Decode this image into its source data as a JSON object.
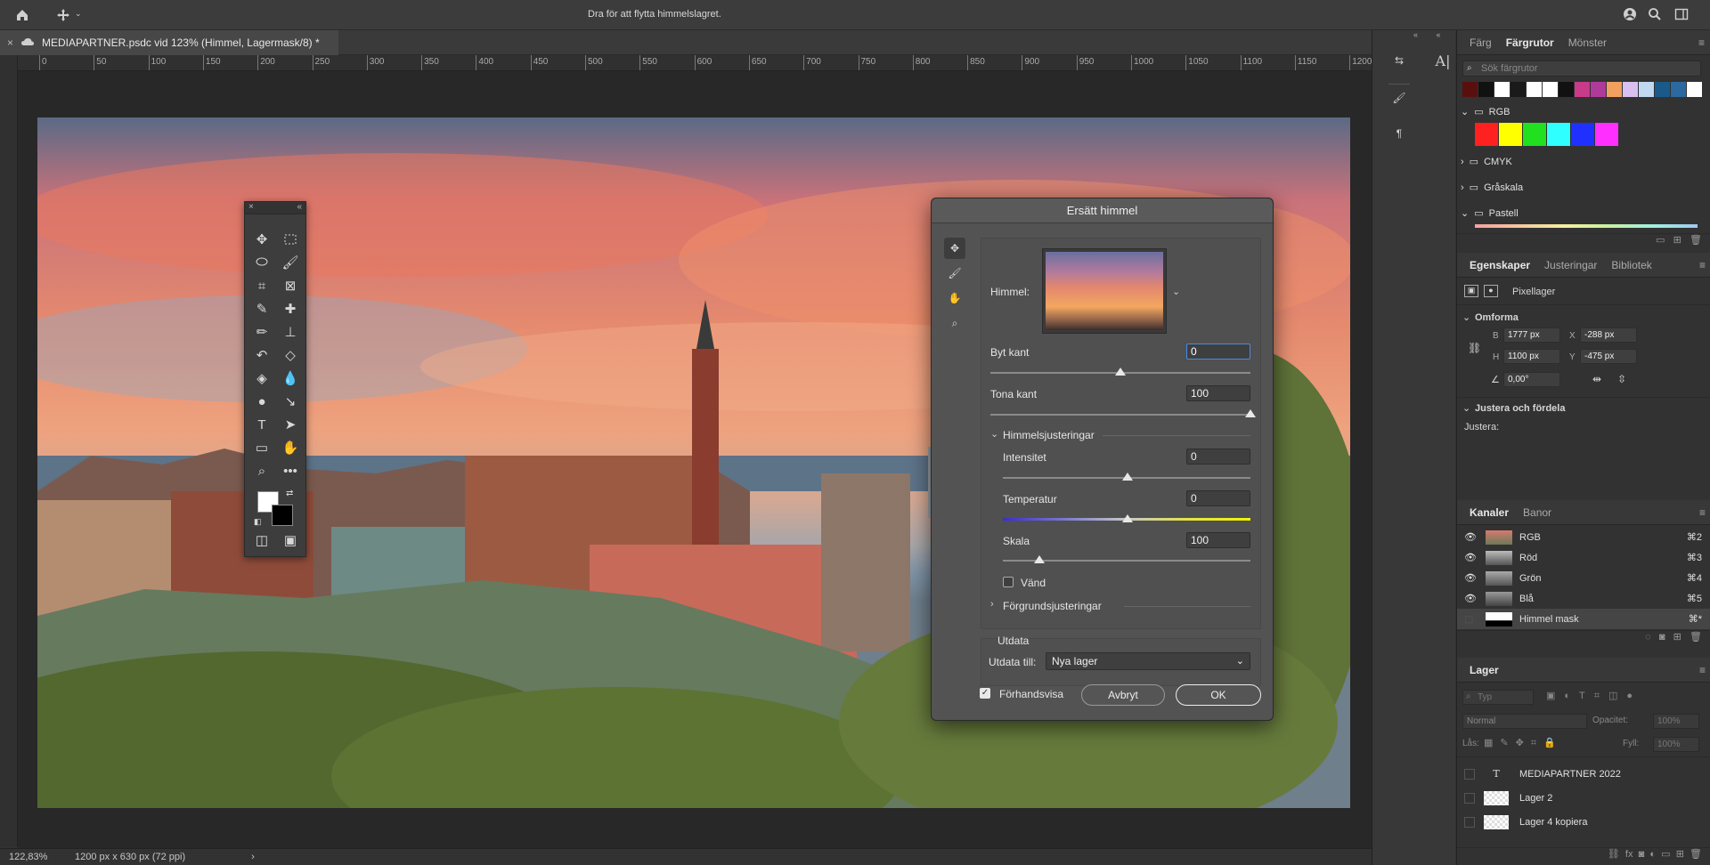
{
  "topbar": {
    "hint": "Dra för att flytta himmelslagret."
  },
  "document": {
    "tab_title": "MEDIAPARTNER.psdc vid 123% (Himmel, Lagermask/8) *"
  },
  "ruler": {
    "h_ticks": [
      "0",
      "50",
      "100",
      "150",
      "200",
      "250",
      "300",
      "350",
      "400",
      "450",
      "500",
      "550",
      "600",
      "650",
      "700",
      "750",
      "800",
      "850",
      "900",
      "950",
      "1000",
      "1050",
      "1100",
      "1150",
      "1200"
    ]
  },
  "status": {
    "zoom": "122,83%",
    "size": "1200 px x 630 px (72 ppi)"
  },
  "dialog": {
    "title": "Ersätt himmel",
    "sky_label": "Himmel:",
    "shift_edge": {
      "label": "Byt kant",
      "value": "0"
    },
    "fade_edge": {
      "label": "Tona kant",
      "value": "100"
    },
    "sky_adjust": {
      "label": "Himmelsjusteringar"
    },
    "brightness": {
      "label": "Intensitet",
      "value": "0"
    },
    "temperature": {
      "label": "Temperatur",
      "value": "0"
    },
    "scale": {
      "label": "Skala",
      "value": "100"
    },
    "flip": {
      "label": "Vänd"
    },
    "foreground": {
      "label": "Förgrundsjusteringar"
    },
    "output": {
      "section": "Utdata",
      "label": "Utdata till:",
      "value": "Nya lager"
    },
    "preview": {
      "label": "Förhandsvisa"
    },
    "cancel": "Avbryt",
    "ok": "OK"
  },
  "swatches_panel": {
    "tabs": [
      "Färg",
      "Färgrutor",
      "Mönster"
    ],
    "search_placeholder": "Sök färgrutor",
    "groups": [
      "RGB",
      "CMYK",
      "Gråskala",
      "Pastell"
    ]
  },
  "properties_panel": {
    "tabs": [
      "Egenskaper",
      "Justeringar",
      "Bibliotek"
    ],
    "layer_type": "Pixellager",
    "transform_title": "Omforma",
    "w_label": "B",
    "w": "1777 px",
    "x_label": "X",
    "x": "-288 px",
    "h_label": "H",
    "h": "1100 px",
    "y_label": "Y",
    "y": "-475 px",
    "angle": "0,00°",
    "align_title": "Justera och fördela",
    "align_label": "Justera:"
  },
  "channels_panel": {
    "tabs": [
      "Kanaler",
      "Banor"
    ],
    "channels": [
      {
        "name": "RGB",
        "shortcut": "⌘2"
      },
      {
        "name": "Röd",
        "shortcut": "⌘3"
      },
      {
        "name": "Grön",
        "shortcut": "⌘4"
      },
      {
        "name": "Blå",
        "shortcut": "⌘5"
      },
      {
        "name": "Himmel mask",
        "shortcut": "⌘*"
      }
    ]
  },
  "layers_panel": {
    "title": "Lager",
    "filter_placeholder": "Typ",
    "blend_mode": "Normal",
    "opacity_label": "Opacitet:",
    "opacity": "100%",
    "lock_label": "Lås:",
    "fill_label": "Fyll:",
    "fill": "100%",
    "layers": [
      "MEDIAPARTNER 2022",
      "Lager 2",
      "Lager 4 kopiera"
    ]
  }
}
